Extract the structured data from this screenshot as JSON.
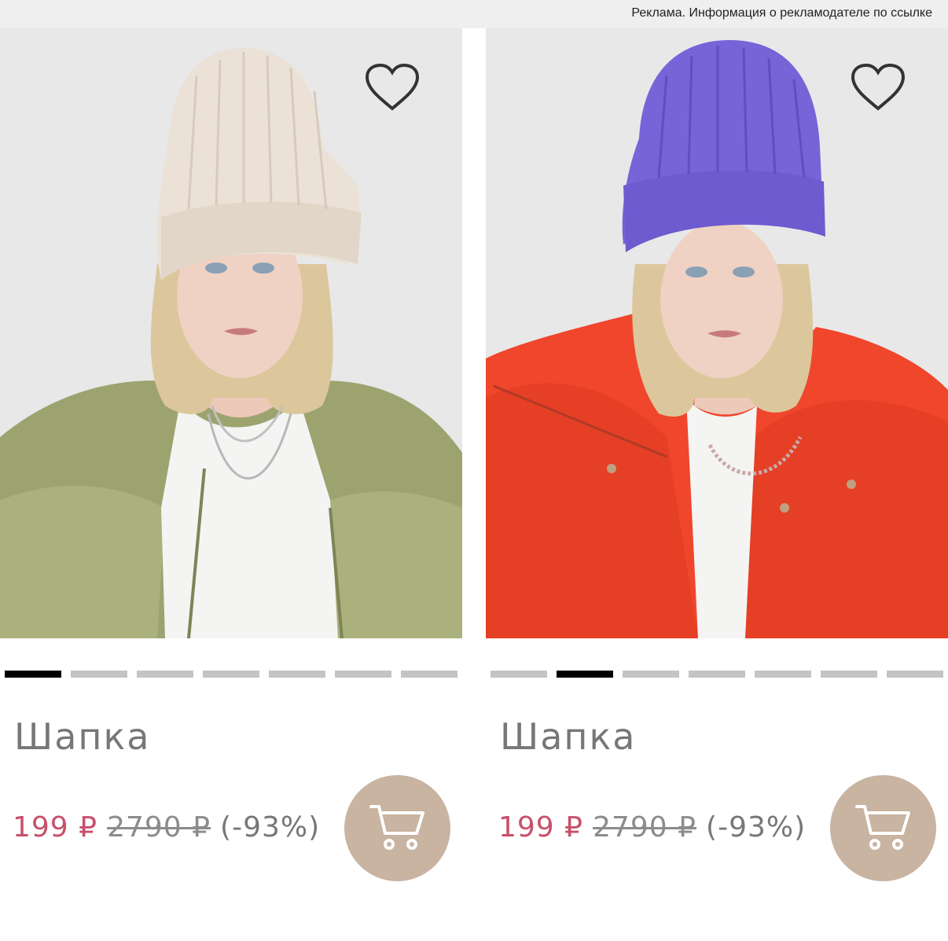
{
  "ad_notice": "Реклама. Информация о рекламодателе по ссылке",
  "colors": {
    "price_accent": "#c8506a",
    "cart_button": "#c9b3a1",
    "indicator_active": "#000000",
    "indicator_inactive": "#c4c4c4"
  },
  "products": [
    {
      "title": "Шапка",
      "price": "199 ₽",
      "old_price": "2790 ₽",
      "discount": "(-93%)",
      "favorite_icon": "heart-outline-icon",
      "cart_icon": "shopping-cart-icon",
      "image_count": 7,
      "active_image": 1
    },
    {
      "title": "Шапка",
      "price": "199 ₽",
      "old_price": "2790 ₽",
      "discount": "(-93%)",
      "favorite_icon": "heart-outline-icon",
      "cart_icon": "shopping-cart-icon",
      "image_count": 7,
      "active_image": 2
    }
  ]
}
